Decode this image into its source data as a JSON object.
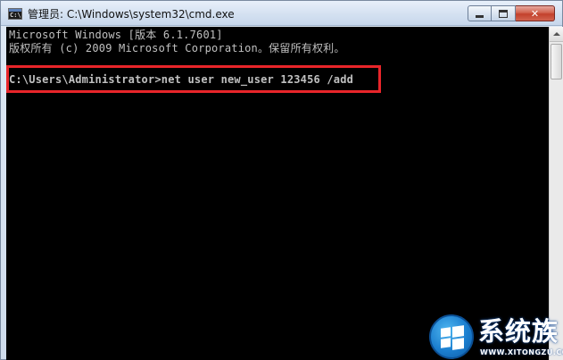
{
  "window": {
    "title": "管理员: C:\\Windows\\system32\\cmd.exe",
    "app_icon_label": "C:\\",
    "close_symbol": "✕"
  },
  "console": {
    "lines": [
      "Microsoft Windows [版本 6.1.7601]",
      "版权所有 (c) 2009 Microsoft Corporation。保留所有权利。",
      "C:\\Users\\Administrator>net user new_user 123456 /add"
    ]
  },
  "colors": {
    "console_bg": "#000000",
    "console_text": "#c0c0c0",
    "highlight_border": "#e8252a"
  },
  "watermark": {
    "name": "系统族",
    "url": "WWW.XITONGZU.COM"
  }
}
